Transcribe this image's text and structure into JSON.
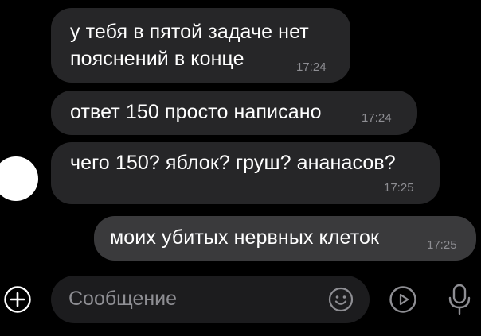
{
  "messages": [
    {
      "text_line1": "у тебя в пятой задаче нет",
      "text_line2": "пояснений в конце",
      "time": "17:24",
      "direction": "in"
    },
    {
      "text": "ответ 150 просто написано",
      "time": "17:24",
      "direction": "in"
    },
    {
      "text": "чего 150? яблок? груш? ананасов?",
      "time": "17:25",
      "direction": "in"
    },
    {
      "text": "моих убитых нервных клеток",
      "time": "17:25",
      "direction": "out"
    }
  ],
  "composer": {
    "placeholder": "Сообщение"
  },
  "icons": {
    "add": "plus-circle-icon",
    "emoji": "smiley-icon",
    "send": "play-circle-icon",
    "mic": "microphone-icon"
  },
  "colors": {
    "background": "#000000",
    "incoming_bubble": "#262628",
    "outgoing_bubble": "#3a3a3c",
    "secondary_text": "#8e8e93"
  }
}
